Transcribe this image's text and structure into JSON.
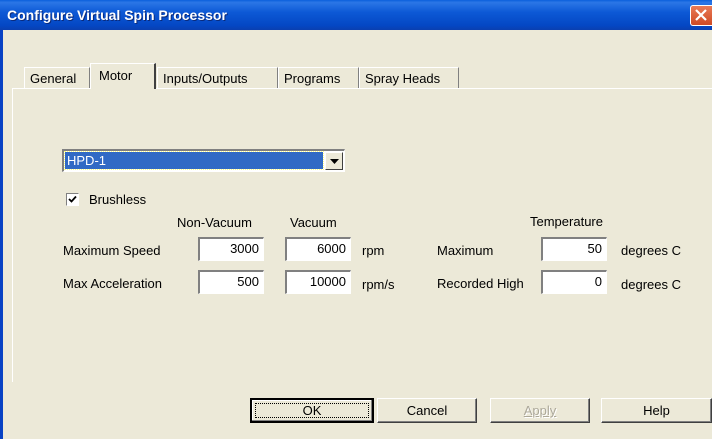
{
  "window": {
    "title": "Configure Virtual Spin Processor",
    "close_icon": "close-icon"
  },
  "tabs": [
    {
      "label": "General",
      "active": false
    },
    {
      "label": "Motor",
      "active": true
    },
    {
      "label": "Inputs/Outputs",
      "active": false
    },
    {
      "label": "Programs",
      "active": false
    },
    {
      "label": "Spray Heads",
      "active": false
    }
  ],
  "motor": {
    "model_select": {
      "value": "HPD-1"
    },
    "brushless": {
      "label": "Brushless",
      "checked": true
    },
    "columns": {
      "non_vacuum": "Non-Vacuum",
      "vacuum": "Vacuum",
      "temperature": "Temperature"
    },
    "max_speed": {
      "label": "Maximum Speed",
      "non_vacuum": "3000",
      "vacuum": "6000",
      "unit": "rpm"
    },
    "max_accel": {
      "label": "Max Acceleration",
      "non_vacuum": "500",
      "vacuum": "10000",
      "unit": "rpm/s"
    },
    "temp_max": {
      "label": "Maximum",
      "value": "50",
      "unit": "degrees C"
    },
    "temp_recorded": {
      "label": "Recorded High",
      "value": "0",
      "unit": "degrees C"
    }
  },
  "buttons": {
    "ok": "OK",
    "cancel": "Cancel",
    "apply": "Apply",
    "help": "Help"
  },
  "colors": {
    "title_bar": "#0447c4",
    "dialog_bg": "#ece9d8",
    "selection": "#316ac5",
    "close_button": "#cf4a24"
  }
}
